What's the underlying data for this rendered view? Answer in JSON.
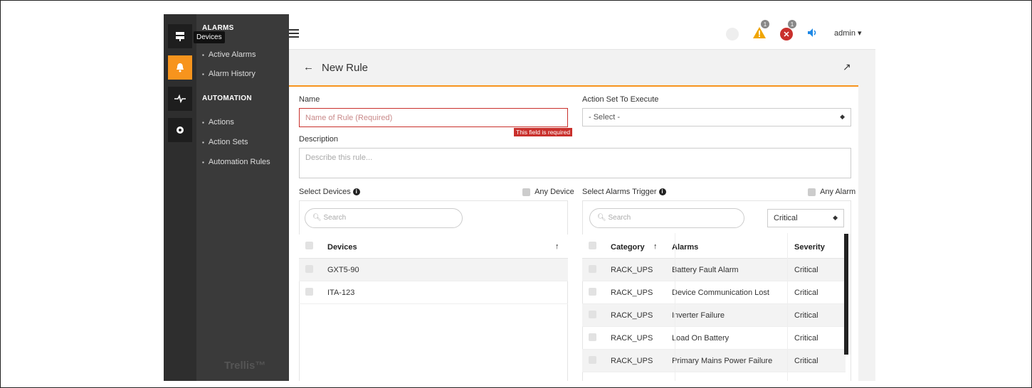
{
  "tooltip": "Devices",
  "subnav": {
    "alarms_header": "ALARMS",
    "alarms_items": [
      "Active Alarms",
      "Alarm History"
    ],
    "automation_header": "AUTOMATION",
    "automation_items": [
      "Actions",
      "Action Sets",
      "Automation Rules"
    ],
    "brand": "Trellis™"
  },
  "rail_icons": [
    "devices-icon",
    "alarm-icon",
    "pulse-icon",
    "gear-icon"
  ],
  "topbar": {
    "menu_icon": "hamburger-icon",
    "warning_count": "1",
    "error_count": "1",
    "user": "admin ▾"
  },
  "page": {
    "back": "←",
    "title": "New Rule",
    "expand": "↗"
  },
  "form": {
    "name_label": "Name",
    "name_placeholder": "Name of Rule (Required)",
    "name_error": "This field is required",
    "action_set_label": "Action Set To Execute",
    "action_set_value": "- Select -",
    "description_label": "Description",
    "description_placeholder": "Describe this rule..."
  },
  "devices": {
    "label": "Select Devices",
    "any_label": "Any Device",
    "search_placeholder": "Search",
    "column": "Devices",
    "sort_arrow": "↑",
    "rows": [
      "GXT5-90",
      "ITA-123"
    ]
  },
  "alarms": {
    "label": "Select Alarms Trigger",
    "any_label": "Any Alarm",
    "search_placeholder": "Search",
    "severity_filter": "Critical",
    "columns": {
      "category": "Category",
      "alarms": "Alarms",
      "severity": "Severity"
    },
    "sort_arrow": "↑",
    "rows": [
      {
        "category": "RACK_UPS",
        "alarm": "Battery Fault Alarm",
        "severity": "Critical"
      },
      {
        "category": "RACK_UPS",
        "alarm": "Device Communication Lost",
        "severity": "Critical"
      },
      {
        "category": "RACK_UPS",
        "alarm": "Inverter Failure",
        "severity": "Critical"
      },
      {
        "category": "RACK_UPS",
        "alarm": "Load On Battery",
        "severity": "Critical"
      },
      {
        "category": "RACK_UPS",
        "alarm": "Primary Mains Power Failure",
        "severity": "Critical"
      }
    ]
  },
  "colors": {
    "accent": "#f7941d",
    "error": "#c9302c",
    "warning": "#f0a500",
    "sound": "#1e88e5"
  }
}
